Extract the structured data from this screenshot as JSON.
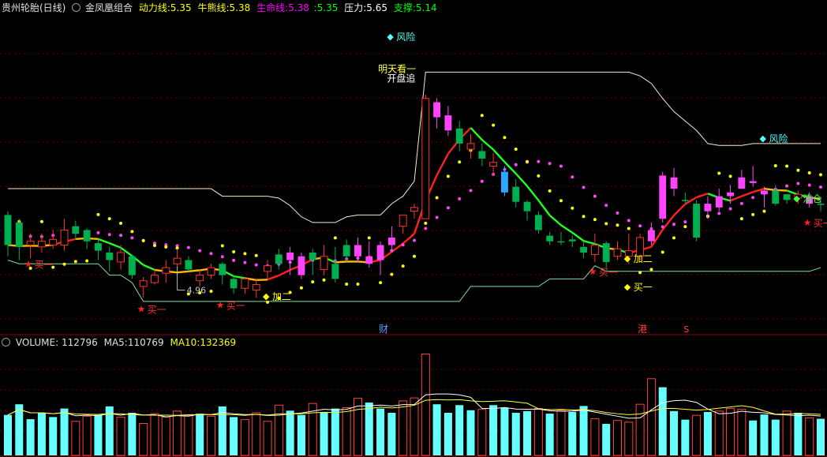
{
  "header": {
    "stock_name": "贵州轮胎(日线)",
    "indicator_name": "金凤凰组合",
    "lines": [
      {
        "label": "动力线:",
        "value": "5.35",
        "color": "#ffff00"
      },
      {
        "label": "牛熊线:",
        "value": "5.38",
        "color": "#ffff00"
      },
      {
        "label": "生命线:",
        "value": "5.38",
        "color": "#ff00ff"
      },
      {
        "label": ":",
        "value": "5.35",
        "color": "#00ff00"
      },
      {
        "label": "压力:",
        "value": "5.65",
        "color": "#ffffff"
      },
      {
        "label": "支撑:",
        "value": "5.14",
        "color": "#00ff00"
      }
    ]
  },
  "volume_header": {
    "label": "VOLUME:",
    "value": "112796",
    "ma5_label": "MA5:",
    "ma5_value": "110769",
    "ma10_label": "MA10:",
    "ma10_value": "132369"
  },
  "annotations": {
    "low_price": "4.96",
    "buy1": "买一",
    "add2": "加二",
    "clear": "清仓",
    "risk": "风险",
    "open_chase": "开盘追",
    "top_label": "明天看一",
    "news_fin": "财",
    "news_hk": "港",
    "news_s": "S"
  },
  "colors": {
    "up": "#ff3232",
    "down": "#00b050",
    "magenta": "#ff44ff",
    "gray": "#a0a0a0",
    "cyan": "#55ffff",
    "yellow": "#ffff00"
  },
  "chart_data": {
    "type": "candlestick",
    "price_range": [
      4.6,
      6.28
    ],
    "candles": [
      [
        5.22,
        5.06,
        5.24,
        5.0,
        "d"
      ],
      [
        5.18,
        5.05,
        5.2,
        4.98,
        "d"
      ],
      [
        5.08,
        5.06,
        5.12,
        4.99,
        "u"
      ],
      [
        5.08,
        5.05,
        5.12,
        5.02,
        "u"
      ],
      [
        5.06,
        5.09,
        5.14,
        5.04,
        "u"
      ],
      [
        5.06,
        5.14,
        5.2,
        5.03,
        "u"
      ],
      [
        5.16,
        5.12,
        5.19,
        5.09,
        "d"
      ],
      [
        5.14,
        5.08,
        5.15,
        5.04,
        "d"
      ],
      [
        5.07,
        5.03,
        5.09,
        4.98,
        "d"
      ],
      [
        5.02,
        4.98,
        5.05,
        4.92,
        "d"
      ],
      [
        4.97,
        5.02,
        5.06,
        4.93,
        "u"
      ],
      [
        5.0,
        4.9,
        5.01,
        4.88,
        "d"
      ],
      [
        4.87,
        4.84,
        4.89,
        4.78,
        "u"
      ],
      [
        4.86,
        4.9,
        4.93,
        4.85,
        "u"
      ],
      [
        4.91,
        4.94,
        4.98,
        4.86,
        "u"
      ],
      [
        4.96,
        4.99,
        5.04,
        4.94,
        "u"
      ],
      [
        4.98,
        4.93,
        5.0,
        4.92,
        "d"
      ],
      [
        4.9,
        4.87,
        4.93,
        4.84,
        "u"
      ],
      [
        4.9,
        4.94,
        4.96,
        4.88,
        "u"
      ],
      [
        4.96,
        4.9,
        4.97,
        4.85,
        "d"
      ],
      [
        4.88,
        4.83,
        4.9,
        4.8,
        "d"
      ],
      [
        4.83,
        4.88,
        4.89,
        4.8,
        "u"
      ],
      [
        4.85,
        4.82,
        4.88,
        4.78,
        "u"
      ],
      [
        4.92,
        4.95,
        4.98,
        4.88,
        "u"
      ],
      [
        4.96,
        5.01,
        5.04,
        4.93,
        "d"
      ],
      [
        5.02,
        4.98,
        5.05,
        4.9,
        "m"
      ],
      [
        4.9,
        5.0,
        5.02,
        4.88,
        "m"
      ],
      [
        5.02,
        4.98,
        5.04,
        4.9,
        "d"
      ],
      [
        4.93,
        5.0,
        5.06,
        4.9,
        "u"
      ],
      [
        4.96,
        4.88,
        5.05,
        4.86,
        "d"
      ],
      [
        5.06,
        5.0,
        5.09,
        4.98,
        "d"
      ],
      [
        5.06,
        5.0,
        5.1,
        4.97,
        "m"
      ],
      [
        5.0,
        4.96,
        5.08,
        4.94,
        "m"
      ],
      [
        4.98,
        5.06,
        5.08,
        4.9,
        "m"
      ],
      [
        5.06,
        5.1,
        5.16,
        5.03,
        "m"
      ],
      [
        5.16,
        5.22,
        5.2,
        5.12,
        "u"
      ],
      [
        5.24,
        5.26,
        5.28,
        5.2,
        "u"
      ],
      [
        5.2,
        5.84,
        5.86,
        5.2,
        "u"
      ],
      [
        5.82,
        5.74,
        5.84,
        5.68,
        "m"
      ],
      [
        5.75,
        5.67,
        5.8,
        5.64,
        "m"
      ],
      [
        5.68,
        5.6,
        5.72,
        5.56,
        "d"
      ],
      [
        5.6,
        5.57,
        5.65,
        5.52,
        "u"
      ],
      [
        5.56,
        5.52,
        5.6,
        5.48,
        "d"
      ],
      [
        5.5,
        5.48,
        5.55,
        5.43,
        "u"
      ],
      [
        5.45,
        5.34,
        5.48,
        5.32,
        "b"
      ],
      [
        5.37,
        5.29,
        5.41,
        5.26,
        "d"
      ],
      [
        5.29,
        5.24,
        5.3,
        5.19,
        "d"
      ],
      [
        5.22,
        5.14,
        5.24,
        5.12,
        "d"
      ],
      [
        5.11,
        5.08,
        5.13,
        5.06,
        "d"
      ],
      [
        5.08,
        5.08,
        5.13,
        5.06,
        "d"
      ],
      [
        5.08,
        5.09,
        5.11,
        5.05,
        "d"
      ],
      [
        5.05,
        5.02,
        5.08,
        4.99,
        "d"
      ],
      [
        5.01,
        5.06,
        5.12,
        4.97,
        "u"
      ],
      [
        5.07,
        4.97,
        5.08,
        4.94,
        "d"
      ],
      [
        5.0,
        5.04,
        5.08,
        4.98,
        "u"
      ],
      [
        5.03,
        5.0,
        5.12,
        4.96,
        "u"
      ],
      [
        5.0,
        5.1,
        5.12,
        4.98,
        "u"
      ],
      [
        5.08,
        5.14,
        5.18,
        5.06,
        "m"
      ],
      [
        5.2,
        5.43,
        5.45,
        5.18,
        "m"
      ],
      [
        5.36,
        5.42,
        5.47,
        5.32,
        "m"
      ],
      [
        5.3,
        5.3,
        5.34,
        5.28,
        "d"
      ],
      [
        5.1,
        5.28,
        5.3,
        5.08,
        "d"
      ],
      [
        5.28,
        5.24,
        5.32,
        5.2,
        "m"
      ],
      [
        5.26,
        5.32,
        5.36,
        5.24,
        "m"
      ],
      [
        5.32,
        5.34,
        5.38,
        5.28,
        "m"
      ],
      [
        5.36,
        5.42,
        5.46,
        5.36,
        "m"
      ],
      [
        5.4,
        5.39,
        5.48,
        5.37,
        "m"
      ],
      [
        5.35,
        5.33,
        5.37,
        5.26,
        "m"
      ],
      [
        5.35,
        5.28,
        5.38,
        5.27,
        "d"
      ],
      [
        5.3,
        5.33,
        5.33,
        5.28,
        "d"
      ],
      [
        5.33,
        5.31,
        5.35,
        5.28,
        "u"
      ],
      [
        5.28,
        5.32,
        5.34,
        5.26,
        "m"
      ],
      [
        5.28,
        5.28,
        5.31,
        5.24,
        "d"
      ]
    ],
    "volume_range": [
      0,
      250000
    ],
    "volumes": [
      [
        95000,
        "c"
      ],
      [
        120000,
        "c"
      ],
      [
        85000,
        "c"
      ],
      [
        100000,
        "c"
      ],
      [
        90000,
        "c"
      ],
      [
        110000,
        "c"
      ],
      [
        80000,
        "u"
      ],
      [
        92000,
        "u"
      ],
      [
        95000,
        "c"
      ],
      [
        115000,
        "c"
      ],
      [
        90000,
        "u"
      ],
      [
        100000,
        "c"
      ],
      [
        75000,
        "u"
      ],
      [
        98000,
        "u"
      ],
      [
        90000,
        "u"
      ],
      [
        104000,
        "u"
      ],
      [
        94000,
        "u"
      ],
      [
        98000,
        "c"
      ],
      [
        92000,
        "u"
      ],
      [
        115000,
        "c"
      ],
      [
        90000,
        "c"
      ],
      [
        84000,
        "u"
      ],
      [
        100000,
        "u"
      ],
      [
        80000,
        "u"
      ],
      [
        118000,
        "u"
      ],
      [
        105000,
        "c"
      ],
      [
        95000,
        "c"
      ],
      [
        122000,
        "u"
      ],
      [
        102000,
        "c"
      ],
      [
        110000,
        "c"
      ],
      [
        112000,
        "u"
      ],
      [
        134000,
        "u"
      ],
      [
        124000,
        "c"
      ],
      [
        110000,
        "c"
      ],
      [
        100000,
        "c"
      ],
      [
        128000,
        "u"
      ],
      [
        135000,
        "u"
      ],
      [
        238000,
        "u"
      ],
      [
        120000,
        "c"
      ],
      [
        100000,
        "c"
      ],
      [
        118000,
        "c"
      ],
      [
        106000,
        "c"
      ],
      [
        108000,
        "u"
      ],
      [
        118000,
        "c"
      ],
      [
        112000,
        "c"
      ],
      [
        100000,
        "c"
      ],
      [
        104000,
        "c"
      ],
      [
        110000,
        "u"
      ],
      [
        98000,
        "c"
      ],
      [
        106000,
        "u"
      ],
      [
        102000,
        "c"
      ],
      [
        116000,
        "c"
      ],
      [
        86000,
        "u"
      ],
      [
        74000,
        "c"
      ],
      [
        82000,
        "u"
      ],
      [
        78000,
        "u"
      ],
      [
        120000,
        "u"
      ],
      [
        180000,
        "u"
      ],
      [
        160000,
        "c"
      ],
      [
        104000,
        "c"
      ],
      [
        84000,
        "c"
      ],
      [
        94000,
        "u"
      ],
      [
        102000,
        "c"
      ],
      [
        104000,
        "u"
      ],
      [
        110000,
        "u"
      ],
      [
        108000,
        "u"
      ],
      [
        82000,
        "c"
      ],
      [
        96000,
        "c"
      ],
      [
        84000,
        "c"
      ],
      [
        104000,
        "u"
      ],
      [
        100000,
        "c"
      ],
      [
        88000,
        "u"
      ],
      [
        86000,
        "c"
      ]
    ]
  }
}
